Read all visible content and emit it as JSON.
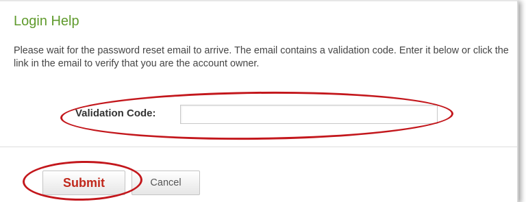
{
  "page": {
    "title": "Login Help",
    "instructions": "Please wait for the password reset email to arrive. The email contains a validation code. Enter it below or click the link in the email to verify that you are the account owner."
  },
  "form": {
    "validation_code_label": "Validation Code:",
    "validation_code_value": "",
    "validation_code_placeholder": ""
  },
  "actions": {
    "submit_label": "Submit",
    "cancel_label": "Cancel"
  },
  "colors": {
    "title_green": "#5f9a2c",
    "submit_red": "#c0281c",
    "annotation_red": "#c3171c"
  }
}
